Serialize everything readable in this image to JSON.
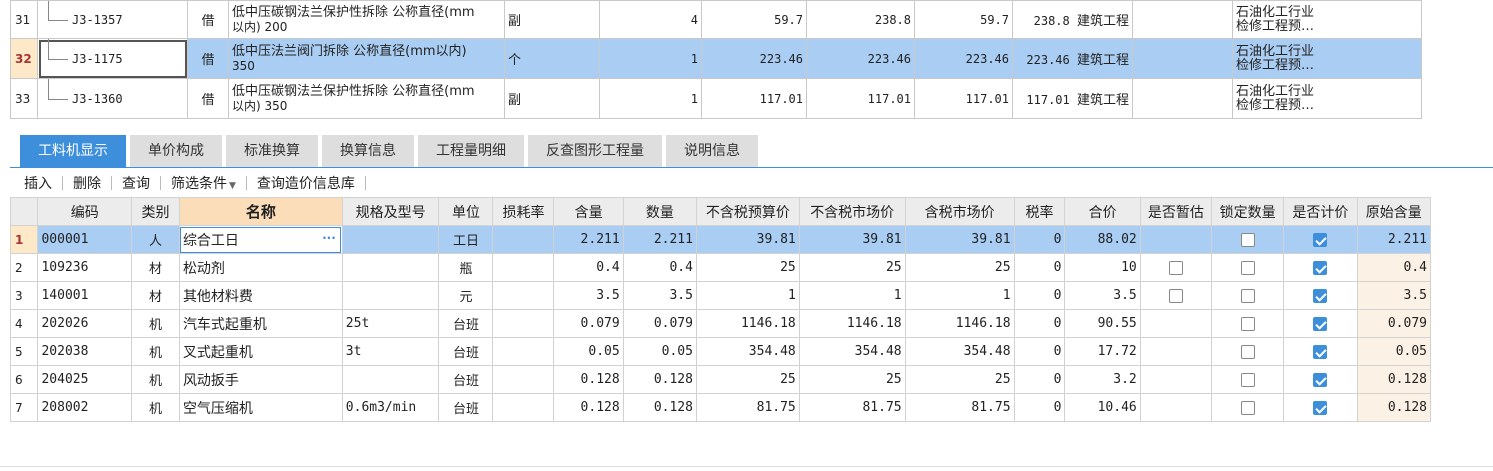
{
  "top_rows": [
    {
      "row": "31",
      "code": "J3-1357",
      "type": "借",
      "name_line1": "低中压碳钢法兰保护性拆除 公称直径(mm",
      "name_line2": "以内) 200",
      "unit": "副",
      "qty": "4",
      "p1": "59.7",
      "p2": "238.8",
      "p3": "59.7",
      "p4": "238.8",
      "category": "建筑工程",
      "extra": "",
      "prof1": "石油化工行业",
      "prof2": "检修工程预…"
    },
    {
      "row": "32",
      "code": "J3-1175",
      "type": "借",
      "name_line1": "低中压法兰阀门拆除 公称直径(mm以内)",
      "name_line2": "350",
      "unit": "个",
      "qty": "1",
      "p1": "223.46",
      "p2": "223.46",
      "p3": "223.46",
      "p4": "223.46",
      "category": "建筑工程",
      "extra": "",
      "prof1": "石油化工行业",
      "prof2": "检修工程预…"
    },
    {
      "row": "33",
      "code": "J3-1360",
      "type": "借",
      "name_line1": "低中压碳钢法兰保护性拆除 公称直径(mm",
      "name_line2": "以内) 350",
      "unit": "副",
      "qty": "1",
      "p1": "117.01",
      "p2": "117.01",
      "p3": "117.01",
      "p4": "117.01",
      "category": "建筑工程",
      "extra": "",
      "prof1": "石油化工行业",
      "prof2": "检修工程预…"
    }
  ],
  "tabs": [
    "工料机显示",
    "单价构成",
    "标准换算",
    "换算信息",
    "工程量明细",
    "反查图形工程量",
    "说明信息"
  ],
  "toolbar": {
    "insert": "插入",
    "delete": "删除",
    "query": "查询",
    "filter": "筛选条件",
    "price_db": "查询造价信息库"
  },
  "grid_headers": [
    "编码",
    "类别",
    "名称",
    "规格及型号",
    "单位",
    "损耗率",
    "含量",
    "数量",
    "不含税预算价",
    "不含税市场价",
    "含税市场价",
    "税率",
    "合价",
    "是否暂估",
    "锁定数量",
    "是否计价",
    "原始含量"
  ],
  "grid_rows": [
    {
      "n": "1",
      "code": "000001",
      "cat": "人",
      "name": "综合工日",
      "spec": "",
      "unit": "工日",
      "loss": "",
      "content": "2.211",
      "qty": "2.211",
      "budget": "39.81",
      "market": "39.81",
      "taxed": "39.81",
      "tax": "0",
      "total": "88.02",
      "est": "none",
      "lock": false,
      "priced": true,
      "orig": "2.211"
    },
    {
      "n": "2",
      "code": "109236",
      "cat": "材",
      "name": "松动剂",
      "spec": "",
      "unit": "瓶",
      "loss": "",
      "content": "0.4",
      "qty": "0.4",
      "budget": "25",
      "market": "25",
      "taxed": "25",
      "tax": "0",
      "total": "10",
      "est": "off",
      "lock": false,
      "priced": true,
      "orig": "0.4"
    },
    {
      "n": "3",
      "code": "140001",
      "cat": "材",
      "name": "其他材料费",
      "spec": "",
      "unit": "元",
      "loss": "",
      "content": "3.5",
      "qty": "3.5",
      "budget": "1",
      "market": "1",
      "taxed": "1",
      "tax": "0",
      "total": "3.5",
      "est": "off",
      "lock": false,
      "priced": true,
      "orig": "3.5"
    },
    {
      "n": "4",
      "code": "202026",
      "cat": "机",
      "name": "汽车式起重机",
      "spec": "25t",
      "unit": "台班",
      "loss": "",
      "content": "0.079",
      "qty": "0.079",
      "budget": "1146.18",
      "market": "1146.18",
      "taxed": "1146.18",
      "tax": "0",
      "total": "90.55",
      "est": "none",
      "lock": false,
      "priced": true,
      "orig": "0.079"
    },
    {
      "n": "5",
      "code": "202038",
      "cat": "机",
      "name": "叉式起重机",
      "spec": "3t",
      "unit": "台班",
      "loss": "",
      "content": "0.05",
      "qty": "0.05",
      "budget": "354.48",
      "market": "354.48",
      "taxed": "354.48",
      "tax": "0",
      "total": "17.72",
      "est": "none",
      "lock": false,
      "priced": true,
      "orig": "0.05"
    },
    {
      "n": "6",
      "code": "204025",
      "cat": "机",
      "name": "风动扳手",
      "spec": "",
      "unit": "台班",
      "loss": "",
      "content": "0.128",
      "qty": "0.128",
      "budget": "25",
      "market": "25",
      "taxed": "25",
      "tax": "0",
      "total": "3.2",
      "est": "none",
      "lock": false,
      "priced": true,
      "orig": "0.128"
    },
    {
      "n": "7",
      "code": "208002",
      "cat": "机",
      "name": "空气压缩机",
      "spec": "0.6m3/min",
      "unit": "台班",
      "loss": "",
      "content": "0.128",
      "qty": "0.128",
      "budget": "81.75",
      "market": "81.75",
      "taxed": "81.75",
      "tax": "0",
      "total": "10.46",
      "est": "none",
      "lock": false,
      "priced": true,
      "orig": "0.128"
    }
  ],
  "colors": {
    "accent": "#3d8fdc",
    "selection": "#a9cdf3",
    "row_marker": "#fde9c8",
    "header": "#ececec"
  }
}
